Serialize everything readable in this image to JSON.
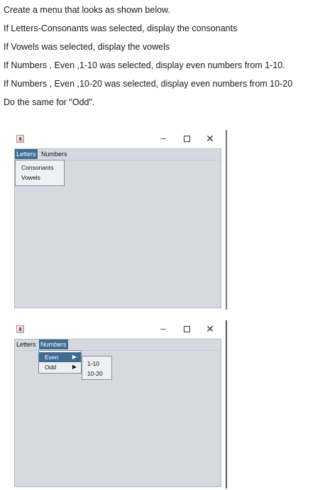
{
  "instructions": [
    "Create a menu that looks as shown below.",
    "If Letters-Consonants was selected, display the consonants",
    "If Vowels was selected, display the vowels",
    "If Numbers , Even ,1-10 was selected, display even numbers from 1-10.",
    "If Numbers , Even ,10-20 was selected, display even numbers from 10-20",
    "Do the same for \"Odd\"."
  ],
  "window_controls": {
    "minimize": "–",
    "close": "✕"
  },
  "window1": {
    "menubar": {
      "letters": "Letters",
      "numbers": "Numbers"
    },
    "letters_menu": [
      "Consonants",
      "Vowels"
    ]
  },
  "window2": {
    "menubar": {
      "letters": "Letters",
      "numbers": "Numbers"
    },
    "numbers_menu": [
      "Even",
      "Odd"
    ],
    "submenu_arrow": "▶",
    "even_submenu": [
      "1-10",
      "10-20"
    ]
  }
}
